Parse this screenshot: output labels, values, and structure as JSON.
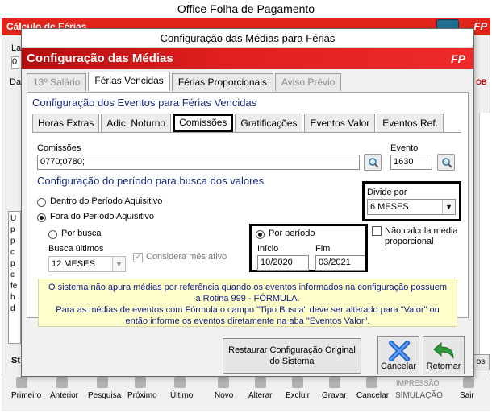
{
  "app": {
    "title": "Office Folha de Pagamento",
    "bg_header": "Cálculo de Férias",
    "bg_logo": "FP",
    "bg_stub_la": "La",
    "bg_stub_0": "0",
    "bg_stub_da": "Da",
    "bg_stub_u": "U\np\np\nc\np\nc\nfe\nh\nd",
    "bg_stub_st": "St",
    "bg_right_text": "OB",
    "bg_right_button": "os",
    "toolbar": [
      {
        "label": "Primeiro",
        "ul": "P",
        "rest": "rimeiro"
      },
      {
        "label": "Anterior",
        "ul": "A",
        "rest": "nterior"
      },
      {
        "label": "Pesquisa",
        "ul": "",
        "rest": "Pesquisa"
      },
      {
        "label": "Próximo",
        "ul": "",
        "rest": "Próximo"
      },
      {
        "label": "Último",
        "ul": "Ú",
        "rest": "ltimo"
      },
      {
        "label": "Novo",
        "ul": "N",
        "rest": "ovo"
      },
      {
        "label": "Alterar",
        "ul": "A",
        "rest": "lterar"
      },
      {
        "label": "Excluir",
        "ul": "E",
        "rest": "xcluir"
      },
      {
        "label": "Gravar",
        "ul": "G",
        "rest": "ravar"
      },
      {
        "label": "Cancelar",
        "ul": "C",
        "rest": "ancelar"
      },
      {
        "label": "SIMULAÇÃO",
        "ul": "",
        "rest": "SIMULAÇÃO"
      },
      {
        "label": "Sair",
        "ul": "S",
        "rest": "air"
      }
    ],
    "toolbar_extra": "IMPRESSÃO"
  },
  "dialog": {
    "title": "Configuração das Médias para Férias",
    "header": "Configuração das Médias",
    "logo": "FP",
    "tabs": [
      {
        "label": "13º Salário",
        "state": "disabled"
      },
      {
        "label": "Férias Vencidas",
        "state": "active"
      },
      {
        "label": "Férias Proporcionais",
        "state": "normal"
      },
      {
        "label": "Aviso Prévio",
        "state": "disabled"
      }
    ],
    "section_title": "Configuração dos Eventos para Férias Vencidas",
    "event_tabs": [
      {
        "label": "Horas Extras",
        "active": false
      },
      {
        "label": "Adic. Noturno",
        "active": false
      },
      {
        "label": "Comissões",
        "active": true
      },
      {
        "label": "Gratificações",
        "active": false
      },
      {
        "label": "Eventos Valor",
        "active": false
      },
      {
        "label": "Eventos Ref.",
        "active": false
      }
    ],
    "comissoes_label": "Comissões",
    "comissoes_value": "0770;0780;",
    "evento_label": "Evento",
    "evento_value": "1630",
    "period_title": "Configuração do período para busca dos valores",
    "radio_dentro": "Dentro do Período Aquisitivo",
    "radio_fora": "Fora do Período Aquisitivo",
    "radio_por_busca": "Por busca",
    "busca_ultimos_label": "Busca últimos",
    "busca_ultimos_value": "12 MESES",
    "considera_mes_ativo": "Considera mês ativo",
    "radio_por_periodo": "Por período",
    "inicio_label": "Início",
    "inicio_value": "10/2020",
    "fim_label": "Fim",
    "fim_value": "03/2021",
    "divide_por_label": "Divide por",
    "divide_por_value": "6 MESES",
    "nao_calcula": "Não calcula média proporcional",
    "info_line1": "O sistema não apura médias por referência quando os eventos informados na configuração possuem",
    "info_line2": "a Rotina 999 - FÓRMULA.",
    "info_line3": "Para as médias de eventos com Fórmula o campo \"Tipo Busca\" deve ser alterado para \"Valor\" ou",
    "info_line4": "então informe os eventos diretamente na aba \"Eventos Valor\".",
    "restore_button": "Restaurar Configuração Original do Sistema",
    "cancel_button": "Cancelar",
    "cancel_ul": "C",
    "return_button": "Retornar",
    "return_ul": "R"
  },
  "colors": {
    "header_red": "#e1251b",
    "section_blue": "#1c2c80",
    "info_bg": "#ffffcc",
    "info_text": "#101b86"
  }
}
